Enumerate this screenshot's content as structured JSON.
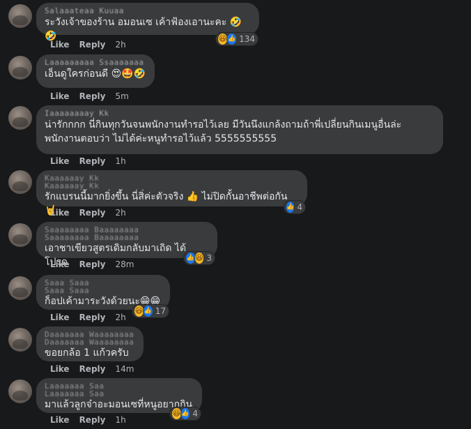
{
  "actions": {
    "like": "Like",
    "reply": "Reply"
  },
  "comments": [
    {
      "author": "Salaaateaa Kuuaa",
      "text": "ระวังเจ้าของร้าน อมอนเซ เค้าฟ้องเอานะคะ 🤣🤣",
      "time": "2h",
      "reactions": [
        "haha-icon",
        "like-icon"
      ],
      "reaction_count": "134"
    },
    {
      "author": "Laaaaaaaaa Ssaaaaaaa",
      "text": "เอ็นดูใครก่อนดี 😍🤩🤣",
      "time": "5m",
      "reactions": [],
      "reaction_count": ""
    },
    {
      "author": "Iaaaaaaaay Kk",
      "text": "น่ารักกกก นี่กินทุกวันจนพนักงานทำรอไว้เลย มีวันนึงแกล้งถามถ้าพี่เปลี่ยนกินเมนูอื่นล่ะ\nพนักงานตอบว่า ไม่ได้ค่ะหนูทำรอไว้แล้ว 5555555555",
      "time": "1h",
      "reactions": [],
      "reaction_count": ""
    },
    {
      "author": "Kaaaaaay Kk",
      "author2": "Kaaaaaay Kk",
      "text": "รักแบรนนี้มากยิ่งขึ้น นี่สิ่ค่ะตัวจริง 👍 ไม่ปิดกั้นอาชีพต่อกัน🤘",
      "time": "2h",
      "reactions": [
        "like-icon"
      ],
      "reaction_count": "4"
    },
    {
      "author": "Saaaaaaaa Baaaaaaaa",
      "author2": "Saaaaaaaa Baaaaaaaa",
      "text": "เอาชาเขียวสูตรเดิมกลับมาเถิด ได้โปรด",
      "time": "28m",
      "reactions": [
        "like-icon",
        "haha-icon"
      ],
      "reaction_count": "3"
    },
    {
      "author": "Saaa Saaa",
      "author2": "Saaa Saaa",
      "text": "ก็อปเค้ามาระวังด้วยนะ😁😁",
      "time": "2h",
      "reactions": [
        "haha-icon",
        "like-icon"
      ],
      "reaction_count": "17"
    },
    {
      "author": "Daaaaaaa Waaaaaaaa",
      "author2": "Daaaaaaa Waaaaaaaa",
      "text": "ขอยกล้อ 1 แก้วครับ",
      "time": "14m",
      "reactions": [],
      "reaction_count": ""
    },
    {
      "author": "Laaaaaaa Saa",
      "author2": "Laaaaaaa Saa",
      "text": "มาแล้วลูกจ๋าอะมอนเซที่หนูอยากกิน",
      "time": "1h",
      "reactions": [
        "haha-icon",
        "like-icon"
      ],
      "reaction_count": "4"
    }
  ]
}
